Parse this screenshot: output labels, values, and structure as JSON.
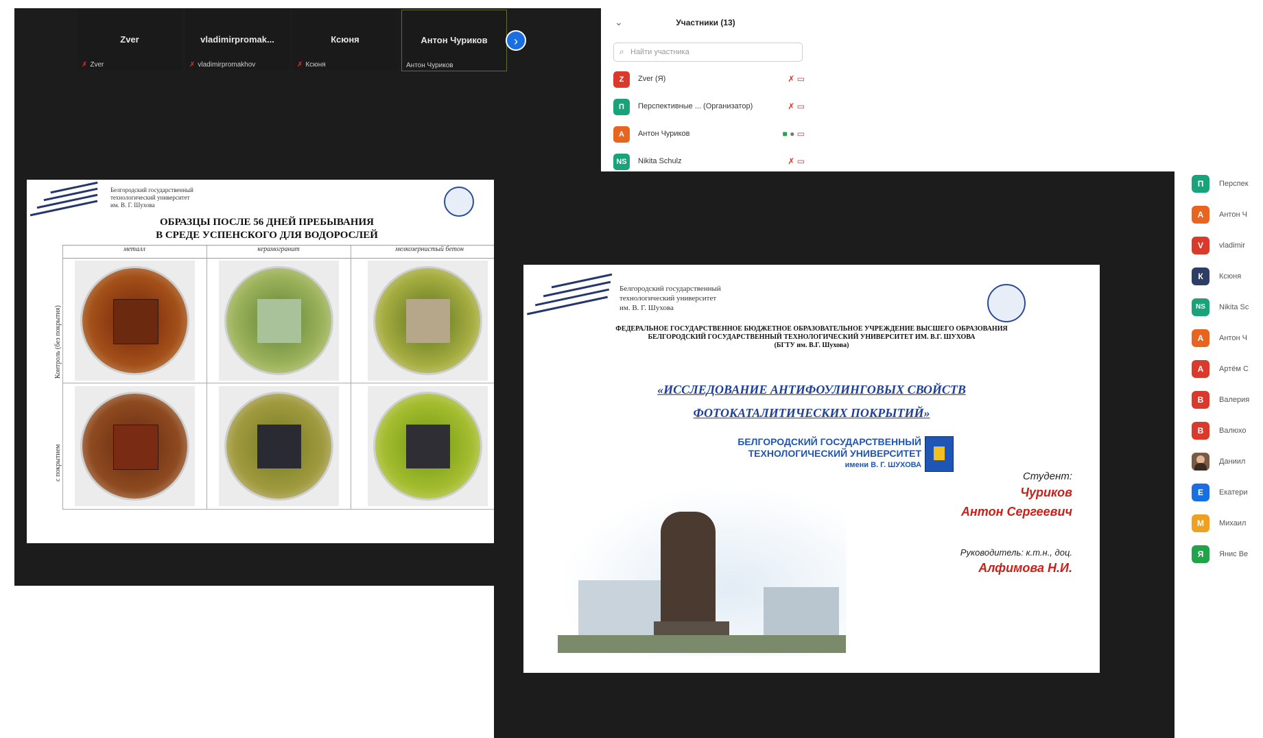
{
  "gallery": {
    "tiles": [
      {
        "name": "Zver",
        "sub": "Zver"
      },
      {
        "name": "vladimirpromak...",
        "sub": "vladimirpromakhov"
      },
      {
        "name": "Ксюня",
        "sub": "Ксюня"
      },
      {
        "name": "Антон Чуриков",
        "sub": "Антон Чуриков"
      }
    ],
    "next_icon": "›"
  },
  "slide1": {
    "uni_lines": [
      "Белгородский государственный",
      "технологический университет",
      "им. В. Г. Шухова"
    ],
    "title_line1": "ОБРАЗЦЫ ПОСЛЕ 56 ДНЕЙ ПРЕБЫВАНИЯ",
    "title_line2": "В СРЕДЕ УСПЕНСКОГО ДЛЯ ВОДОРОСЛЕЙ",
    "columns": [
      "металл",
      "керамогранит",
      "мелкозернистый бетон"
    ],
    "rows": [
      "Контроль (без покрытия)",
      "с покрытием"
    ]
  },
  "participants": {
    "title": "Участники (13)",
    "search_placeholder": "Найти участника",
    "collapse_icon": "⌄",
    "list": [
      {
        "initial": "Z",
        "name": "Zver (Я)",
        "color": "#d93a2b"
      },
      {
        "initial": "П",
        "name": "Перспективные ...  (Организатор)",
        "color": "#1aa37a"
      },
      {
        "initial": "А",
        "name": "Антон Чуриков",
        "color": "#e8651f"
      },
      {
        "initial": "NS",
        "name": "Nikita Schulz",
        "color": "#1aa37a"
      }
    ]
  },
  "slide2": {
    "uni_lines": [
      "Белгородский государственный",
      "технологический университет",
      "им. В. Г. Шухова"
    ],
    "header_line1": "ФЕДЕРАЛЬНОЕ ГОСУДАРСТВЕННОЕ БЮДЖЕТНОЕ ОБРАЗОВАТЕЛЬНОЕ УЧРЕЖДЕНИЕ ВЫСШЕГО ОБРАЗОВАНИЯ",
    "header_line2": "БЕЛГОРОДСКИЙ ГОСУДАРСТВЕННЫЙ ТЕХНОЛОГИЧЕСКИЙ УНИВЕРСИТЕТ ИМ. В.Г. ШУХОВА",
    "header_line3": "(БГТУ им. В.Г. Шухова)",
    "topic_line1": "«ИССЛЕДОВАНИЕ АНТИФОУЛИНГОВЫХ СВОЙСТВ",
    "topic_line2": "ФОТОКАТАЛИТИЧЕСКИХ ПОКРЫТИЙ»",
    "banner_line1": "БЕЛГОРОДСКИЙ ГОСУДАРСТВЕННЫЙ",
    "banner_line2": "ТЕХНОЛОГИЧЕСКИЙ УНИВЕРСИТЕТ",
    "banner_line3": "имени В. Г. ШУХОВА",
    "student_label": "Студент:",
    "student_surname": "Чуриков",
    "student_name": "Антон Сергеевич",
    "advisor_label": "Руководитель: к.т.н., доц.",
    "advisor_name": "Алфимова Н.И."
  },
  "right_list": [
    {
      "initial": "П",
      "name": "Перспек",
      "color": "#1aa37a"
    },
    {
      "initial": "А",
      "name": "Антон Ч",
      "color": "#e8651f"
    },
    {
      "initial": "V",
      "name": "vladimir",
      "color": "#d93a2b"
    },
    {
      "initial": "К",
      "name": "Ксюня",
      "color": "#2c3e66"
    },
    {
      "initial": "NS",
      "name": "Nikita Sc",
      "color": "#1aa37a"
    },
    {
      "initial": "А",
      "name": "Антон Ч",
      "color": "#e8651f"
    },
    {
      "initial": "А",
      "name": "Артём С",
      "color": "#d93a2b"
    },
    {
      "initial": "В",
      "name": "Валерия",
      "color": "#d93a2b"
    },
    {
      "initial": "В",
      "name": "Валюхо",
      "color": "#d93a2b"
    },
    {
      "initial": "",
      "name": "Даниил",
      "color": "#7a5a45"
    },
    {
      "initial": "Е",
      "name": "Екатери",
      "color": "#1a6fe0"
    },
    {
      "initial": "М",
      "name": "Михаил",
      "color": "#f0a020"
    },
    {
      "initial": "Я",
      "name": "Янис Ве",
      "color": "#22a24a"
    }
  ]
}
